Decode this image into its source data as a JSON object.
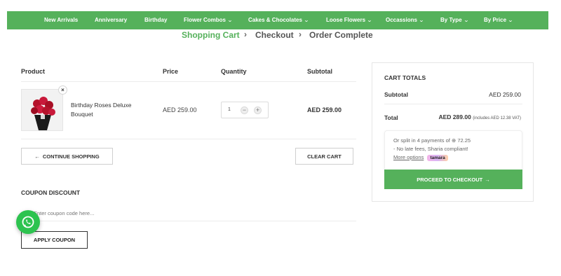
{
  "nav": {
    "items": [
      {
        "label": "New Arrivals",
        "dropdown": false
      },
      {
        "label": "Anniversary",
        "dropdown": false
      },
      {
        "label": "Birthday",
        "dropdown": false
      },
      {
        "label": "Flower Combos",
        "dropdown": true
      },
      {
        "label": "Cakes & Chocolates",
        "dropdown": true
      },
      {
        "label": "Loose Flowers",
        "dropdown": true
      },
      {
        "label": "Occassions",
        "dropdown": true
      },
      {
        "label": "By Type",
        "dropdown": true
      },
      {
        "label": "By Price",
        "dropdown": true
      }
    ]
  },
  "breadcrumb": {
    "steps": [
      "Shopping Cart",
      "Checkout",
      "Order Complete"
    ],
    "separator": "›"
  },
  "cart": {
    "headers": {
      "product": "Product",
      "price": "Price",
      "quantity": "Quantity",
      "subtotal": "Subtotal"
    },
    "items": [
      {
        "name": "Birthday Roses Deluxe Bouquet",
        "price": "AED 259.00",
        "quantity": "1",
        "subtotal": "AED 259.00"
      }
    ],
    "remove_symbol": "×",
    "minus": "−",
    "plus": "+",
    "continue_label": "CONTINUE SHOPPING",
    "continue_arrow": "←",
    "clear_label": "CLEAR CART"
  },
  "coupon": {
    "title": "COUPON DISCOUNT",
    "placeholder": "Enter coupon code here...",
    "apply_label": "APPLY COUPON"
  },
  "totals": {
    "title": "CART TOTALS",
    "subtotal_label": "Subtotal",
    "subtotal_value": "AED 259.00",
    "total_label": "Total",
    "total_value": "AED 289.00",
    "total_note": "(includes AED 12.38 VAT)",
    "tamara_line1": "Or split in 4 payments of ⊕ 72.25",
    "tamara_line2": "- No late fees, Sharia compliant!",
    "tamara_more": "More options",
    "tamara_brand": "tamara",
    "checkout_label": "PROCEED TO CHECKOUT",
    "checkout_arrow": "→"
  },
  "colors": {
    "brand_green": "#55b15b",
    "whatsapp_green": "#2dc34f"
  },
  "icons": {
    "whatsapp": "whatsapp-icon",
    "product_image": "rose-bouquet-image"
  }
}
